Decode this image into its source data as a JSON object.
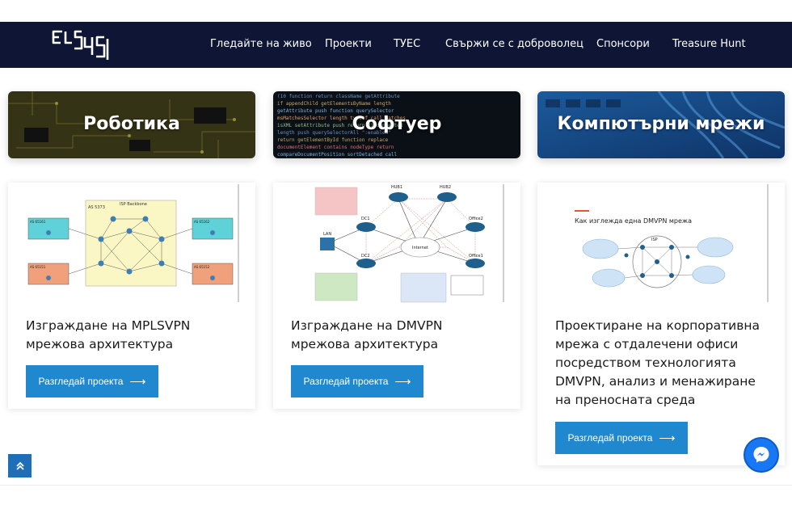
{
  "nav": {
    "logo_text": "ELSYS",
    "items": [
      {
        "label": "Гледайте на живо"
      },
      {
        "label": "Проекти"
      },
      {
        "label": "ТУЕС"
      },
      {
        "label": "Свържи се с доброволец"
      },
      {
        "label": "Спонсори"
      },
      {
        "label": "Treasure Hunt"
      }
    ]
  },
  "categories": [
    {
      "title": "Роботика",
      "icon": "circuit-board-photo"
    },
    {
      "title": "Софтуер",
      "icon": "code-screen-photo"
    },
    {
      "title": "Компютърни мрежи",
      "icon": "network-cables-photo"
    }
  ],
  "projects": [
    {
      "title": "Изграждане на MPLSVPN мрежова архитектура",
      "button_label": "Разгледай проекта",
      "diagram": {
        "backbone": "ISP Backbone",
        "asn": "AS 5373",
        "sites": [
          "AS 65161",
          "AS 65162",
          "AS 65151",
          "AS 65152"
        ]
      }
    },
    {
      "title": "Изграждане на DMVPN мрежова архитектура",
      "button_label": "Разгледай проекта",
      "diagram": {
        "hubs": [
          "HUB1",
          "HUB2"
        ],
        "nodes": [
          "DC1",
          "DC2",
          "Office2",
          "Office1",
          "LAN",
          "Internet"
        ]
      }
    },
    {
      "title": "Проектиране на корпоративна мрежа с отдалечени офиси посредством технологията DMVPN, анализ и менажиране на преносната среда",
      "button_label": "Разгледай проекта",
      "diagram": {
        "heading": "Как изглежда една DMVPN мрежа",
        "center": "ISP"
      }
    }
  ],
  "widgets": {
    "scroll_top_icon": "double-chevron-up-icon",
    "chat_icon": "messenger-icon"
  },
  "colors": {
    "nav_bg": "#0e1535",
    "button_bg": "#1f88cf",
    "scroll_btn": "#1f6fb8",
    "messenger": "#1878f3"
  }
}
